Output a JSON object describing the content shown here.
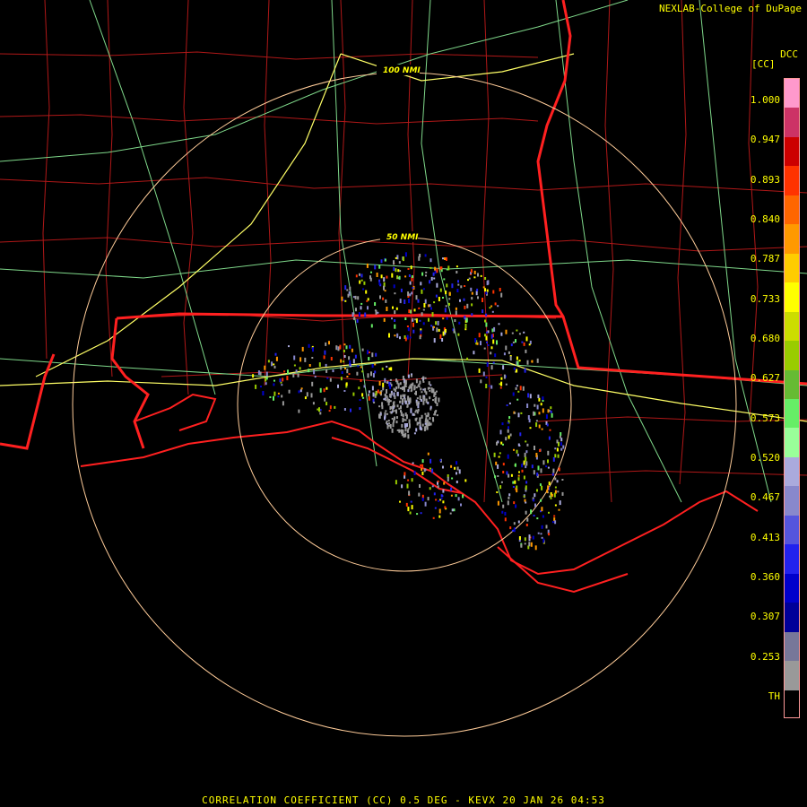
{
  "header": {
    "credit": "NEXLAB-College of DuPage",
    "site": "DCC",
    "units": "[CC]"
  },
  "range_rings": [
    {
      "label": "100 NMI"
    },
    {
      "label": "50 NMI"
    }
  ],
  "colors": {
    "background": "#000000",
    "county_lines": "#b01818",
    "state_lines": "#ff2020",
    "coastline": "#ff2020",
    "highways": "#ffff66",
    "roads": "#7fd88a",
    "range_rings": "#ffcc99",
    "text": "#ffff00"
  },
  "legend": {
    "labels": [
      "1.000",
      "0.947",
      "0.893",
      "0.840",
      "0.787",
      "0.733",
      "0.680",
      "0.627",
      "0.573",
      "0.520",
      "0.467",
      "0.413",
      "0.360",
      "0.307",
      "0.253",
      "TH"
    ],
    "scale": [
      {
        "color": "#ff99cc",
        "value": 1.0
      },
      {
        "color": "#cc3366",
        "value": 0.97
      },
      {
        "color": "#cc0000",
        "value": 0.955
      },
      {
        "color": "#ff3300",
        "value": 0.94
      },
      {
        "color": "#ff6600",
        "value": 0.93
      },
      {
        "color": "#ff9900",
        "value": 0.915
      },
      {
        "color": "#ffcc00",
        "value": 0.905
      },
      {
        "color": "#ffff00",
        "value": 0.89
      },
      {
        "color": "#ccdd00",
        "value": 0.87
      },
      {
        "color": "#99cc00",
        "value": 0.85
      },
      {
        "color": "#66bb33",
        "value": 0.82
      },
      {
        "color": "#66ee66",
        "value": 0.8
      },
      {
        "color": "#99ff99",
        "value": 0.78
      },
      {
        "color": "#aaaadd",
        "value": 0.76
      },
      {
        "color": "#8888cc",
        "value": 0.74
      },
      {
        "color": "#5555dd",
        "value": 0.72
      },
      {
        "color": "#2222ee",
        "value": 0.7
      },
      {
        "color": "#0000cc",
        "value": 0.6
      },
      {
        "color": "#000099",
        "value": 0.45
      },
      {
        "color": "#777799",
        "value": 0.42
      },
      {
        "color": "#999999",
        "value": 0.41
      },
      {
        "color": "#000000",
        "value": 0.2
      }
    ]
  },
  "footer": "CORRELATION COEFFICIENT (CC) 0.5 DEG - KEVX 20 JAN 26 04:53"
}
